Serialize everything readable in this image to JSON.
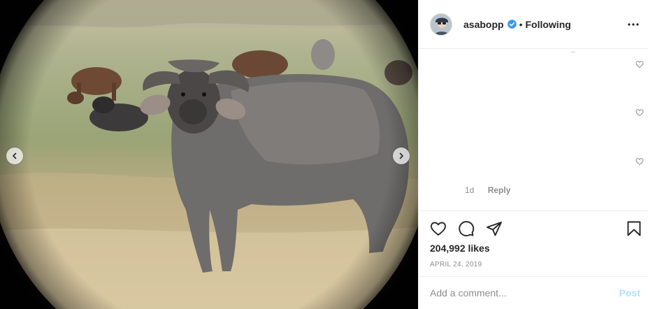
{
  "post": {
    "photo_alt": "Cape buffalo standing in savanna grass with a herd behind it",
    "carousel": {
      "prev_icon": "chevron-left-icon",
      "next_icon": "chevron-right-icon"
    }
  },
  "header": {
    "username": "asabopp",
    "verified": true,
    "separator": "•",
    "follow_state": "Following",
    "more_icon": "more-horizontal-icon"
  },
  "comments": {
    "meta": {
      "time": "1d",
      "reply_label": "Reply"
    },
    "heart_icon": "heart-outline-icon"
  },
  "actions": {
    "like_icon": "heart-icon",
    "comment_icon": "comment-icon",
    "share_icon": "share-icon",
    "save_icon": "bookmark-icon"
  },
  "likes": "204,992 likes",
  "date": "APRIL 24, 2019",
  "comment_box": {
    "placeholder": "Add a comment...",
    "post_label": "Post"
  },
  "colors": {
    "verified": "#3897f0",
    "post_disabled": "#b2dffc",
    "muted": "#8e8e8e",
    "text": "#262626"
  }
}
